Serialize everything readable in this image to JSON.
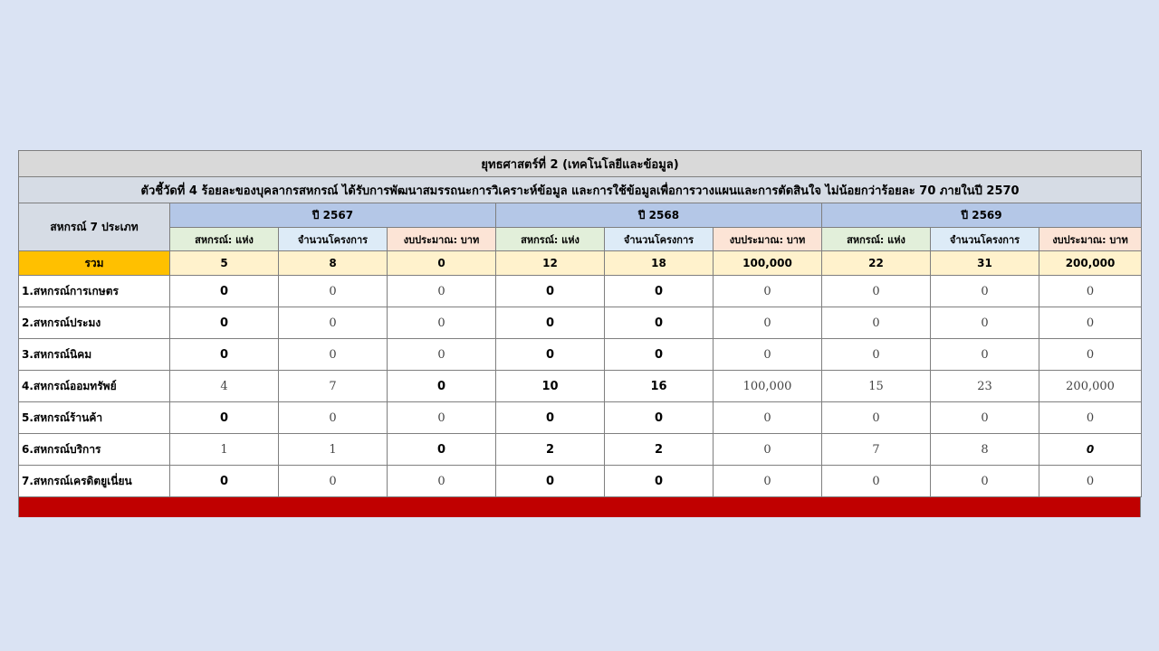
{
  "table": {
    "title": "ยุทธศาสตร์ที่ 2  (เทคโนโลยีและข้อมูล)",
    "indicator": "ตัวชี้วัดที่ 4 ร้อยละของบุคลากรสหกรณ์ ได้รับการพัฒนาสมรรถนะการวิเคราะห์ข้อมูล และการใช้ข้อมูลเพื่อการวางแผนและการตัดสินใจ ไม่น้อยกว่าร้อยละ 70 ภายในปี 2570",
    "group_label": "สหกรณ์ 7 ประเภท",
    "years": [
      "ปี 2567",
      "ปี 2568",
      "ปี 2569"
    ],
    "sub_headers": [
      "สหกรณ์: แห่ง",
      "จำนวนโครงการ",
      "งบประมาณ: บาท"
    ],
    "total": {
      "label": "รวม",
      "values": [
        "5",
        "8",
        "0",
        "12",
        "18",
        "100,000",
        "22",
        "31",
        "200,000"
      ]
    },
    "rows": [
      {
        "label": "1.สหกรณ์การเกษตร",
        "values": [
          "0",
          "0",
          "0",
          "0",
          "0",
          "0",
          "0",
          "0",
          "0"
        ]
      },
      {
        "label": "2.สหกรณ์ประมง",
        "values": [
          "0",
          "0",
          "0",
          "0",
          "0",
          "0",
          "0",
          "0",
          "0"
        ]
      },
      {
        "label": "3.สหกรณ์นิคม",
        "values": [
          "0",
          "0",
          "0",
          "0",
          "0",
          "0",
          "0",
          "0",
          "0"
        ]
      },
      {
        "label": "4.สหกรณ์ออมทรัพย์",
        "values": [
          "4",
          "7",
          "0",
          "10",
          "16",
          "100,000",
          "15",
          "23",
          "200,000"
        ]
      },
      {
        "label": "5.สหกรณ์ร้านค้า",
        "values": [
          "0",
          "0",
          "0",
          "0",
          "0",
          "0",
          "0",
          "0",
          "0"
        ]
      },
      {
        "label": "6.สหกรณ์บริการ",
        "values": [
          "1",
          "1",
          "0",
          "2",
          "2",
          "0",
          "7",
          "8",
          "0"
        ]
      },
      {
        "label": "7.สหกรณ์เครดิตยูเนี่ยน",
        "values": [
          "0",
          "0",
          "0",
          "0",
          "0",
          "0",
          "0",
          "0",
          "0"
        ]
      }
    ]
  },
  "colors": {
    "background": "#dae3f3",
    "title_bg": "#d9d9d9",
    "year_header_bg": "#b4c7e7",
    "total_label_bg": "#ffc000",
    "total_values_bg": "#fff2cc",
    "footer_bar": "#c00000"
  }
}
